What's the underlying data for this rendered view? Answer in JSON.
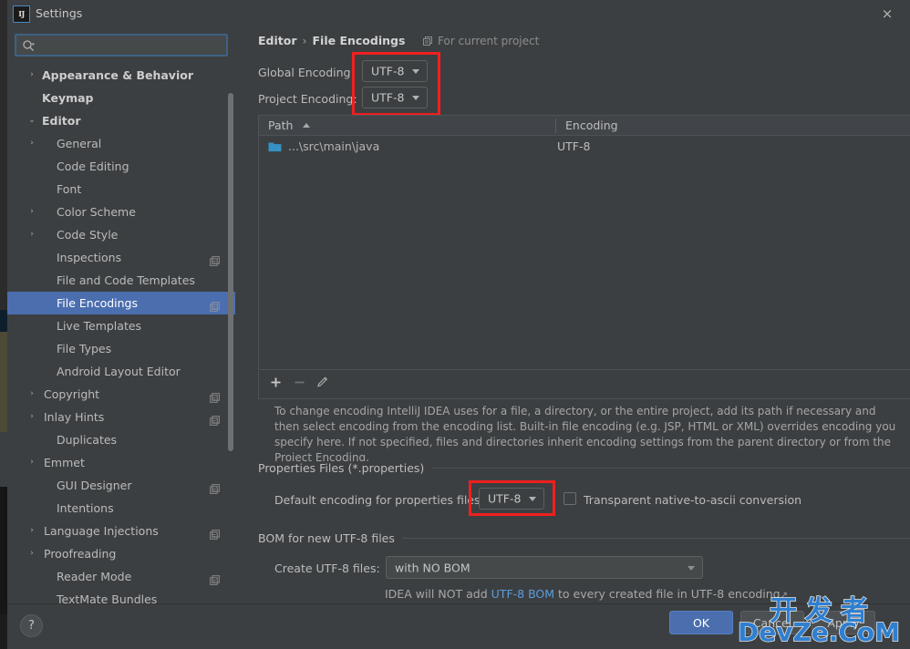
{
  "window": {
    "title": "Settings",
    "logo_text": "IJ",
    "close_label": "×"
  },
  "sidebar": {
    "search": {
      "value": "",
      "placeholder": ""
    },
    "items": [
      {
        "label": "Appearance & Behavior",
        "arrow": "›",
        "indent": 38,
        "bold": true,
        "badge": false,
        "selected": false
      },
      {
        "label": "Keymap",
        "arrow": "",
        "indent": 38,
        "bold": true,
        "badge": false,
        "selected": false
      },
      {
        "label": "Editor",
        "arrow": "⌄",
        "indent": 38,
        "bold": true,
        "badge": false,
        "selected": false
      },
      {
        "label": "General",
        "arrow": "›",
        "indent": 54,
        "bold": false,
        "badge": false,
        "selected": false
      },
      {
        "label": "Code Editing",
        "arrow": "",
        "indent": 54,
        "bold": false,
        "badge": false,
        "selected": false
      },
      {
        "label": "Font",
        "arrow": "",
        "indent": 54,
        "bold": false,
        "badge": false,
        "selected": false
      },
      {
        "label": "Color Scheme",
        "arrow": "›",
        "indent": 54,
        "bold": false,
        "badge": false,
        "selected": false
      },
      {
        "label": "Code Style",
        "arrow": "›",
        "indent": 54,
        "bold": false,
        "badge": false,
        "selected": false
      },
      {
        "label": "Inspections",
        "arrow": "",
        "indent": 54,
        "bold": false,
        "badge": true,
        "selected": false
      },
      {
        "label": "File and Code Templates",
        "arrow": "",
        "indent": 54,
        "bold": false,
        "badge": false,
        "selected": false
      },
      {
        "label": "File Encodings",
        "arrow": "",
        "indent": 54,
        "bold": false,
        "badge": true,
        "selected": true
      },
      {
        "label": "Live Templates",
        "arrow": "",
        "indent": 54,
        "bold": false,
        "badge": false,
        "selected": false
      },
      {
        "label": "File Types",
        "arrow": "",
        "indent": 54,
        "bold": false,
        "badge": false,
        "selected": false
      },
      {
        "label": "Android Layout Editor",
        "arrow": "",
        "indent": 54,
        "bold": false,
        "badge": false,
        "selected": false
      },
      {
        "label": "Copyright",
        "arrow": "›",
        "indent": 40,
        "bold": false,
        "badge": true,
        "selected": false
      },
      {
        "label": "Inlay Hints",
        "arrow": "›",
        "indent": 40,
        "bold": false,
        "badge": true,
        "selected": false
      },
      {
        "label": "Duplicates",
        "arrow": "",
        "indent": 54,
        "bold": false,
        "badge": false,
        "selected": false
      },
      {
        "label": "Emmet",
        "arrow": "›",
        "indent": 40,
        "bold": false,
        "badge": false,
        "selected": false
      },
      {
        "label": "GUI Designer",
        "arrow": "",
        "indent": 54,
        "bold": false,
        "badge": true,
        "selected": false
      },
      {
        "label": "Intentions",
        "arrow": "",
        "indent": 54,
        "bold": false,
        "badge": false,
        "selected": false
      },
      {
        "label": "Language Injections",
        "arrow": "›",
        "indent": 40,
        "bold": false,
        "badge": true,
        "selected": false
      },
      {
        "label": "Proofreading",
        "arrow": "›",
        "indent": 40,
        "bold": false,
        "badge": false,
        "selected": false
      },
      {
        "label": "Reader Mode",
        "arrow": "",
        "indent": 54,
        "bold": false,
        "badge": true,
        "selected": false
      },
      {
        "label": "TextMate Bundles",
        "arrow": "",
        "indent": 54,
        "bold": false,
        "badge": false,
        "selected": false
      }
    ]
  },
  "main": {
    "breadcrumb": {
      "parent": "Editor",
      "separator": "›",
      "current": "File Encodings"
    },
    "scope_note": "For current project",
    "global_encoding": {
      "label": "Global Encoding:",
      "value": "UTF-8"
    },
    "project_encoding": {
      "label": "Project Encoding:",
      "value": "UTF-8"
    },
    "table": {
      "columns": [
        "Path",
        "Encoding"
      ],
      "sort_column": "Path",
      "sort_direction": "ascending",
      "rows": [
        {
          "path": "...\\src\\main\\java",
          "encoding": "UTF-8"
        }
      ]
    },
    "table_toolbar": {
      "add": "+",
      "remove": "−",
      "edit": "edit-pencil"
    },
    "help_text": "To change encoding IntelliJ IDEA uses for a file, a directory, or the entire project, add its path if necessary and then select encoding from the encoding list. Built-in file encoding (e.g. JSP, HTML or XML) overrides encoding you specify here. If not specified, files and directories inherit encoding settings from the parent directory or from the Project Encoding.",
    "properties_group": {
      "title": "Properties Files (*.properties)",
      "default_encoding_label": "Default encoding for properties files:",
      "default_encoding_value": "UTF-8",
      "transparent_label": "Transparent native-to-ascii conversion",
      "transparent_checked": false
    },
    "bom_group": {
      "title": "BOM for new UTF-8 files",
      "create_label": "Create UTF-8 files:",
      "create_value": "with NO BOM",
      "hint_prefix": "IDEA will NOT add ",
      "hint_link": "UTF-8 BOM",
      "hint_suffix": " to every created file in UTF-8 encoding",
      "hint_arrow": "↗"
    }
  },
  "bottom_bar": {
    "help": "?",
    "ok": "OK",
    "cancel": "Cancel",
    "apply": "Apply"
  },
  "watermark": {
    "line1": "开发者",
    "line2": "DevZe.CoM"
  },
  "colors": {
    "accent_selection": "#4b6eaf",
    "panel_bg": "#3c3f41",
    "annotation_red": "#f01f1f",
    "link_blue": "#5a9ddb",
    "folder_blue": "#3592c4"
  }
}
